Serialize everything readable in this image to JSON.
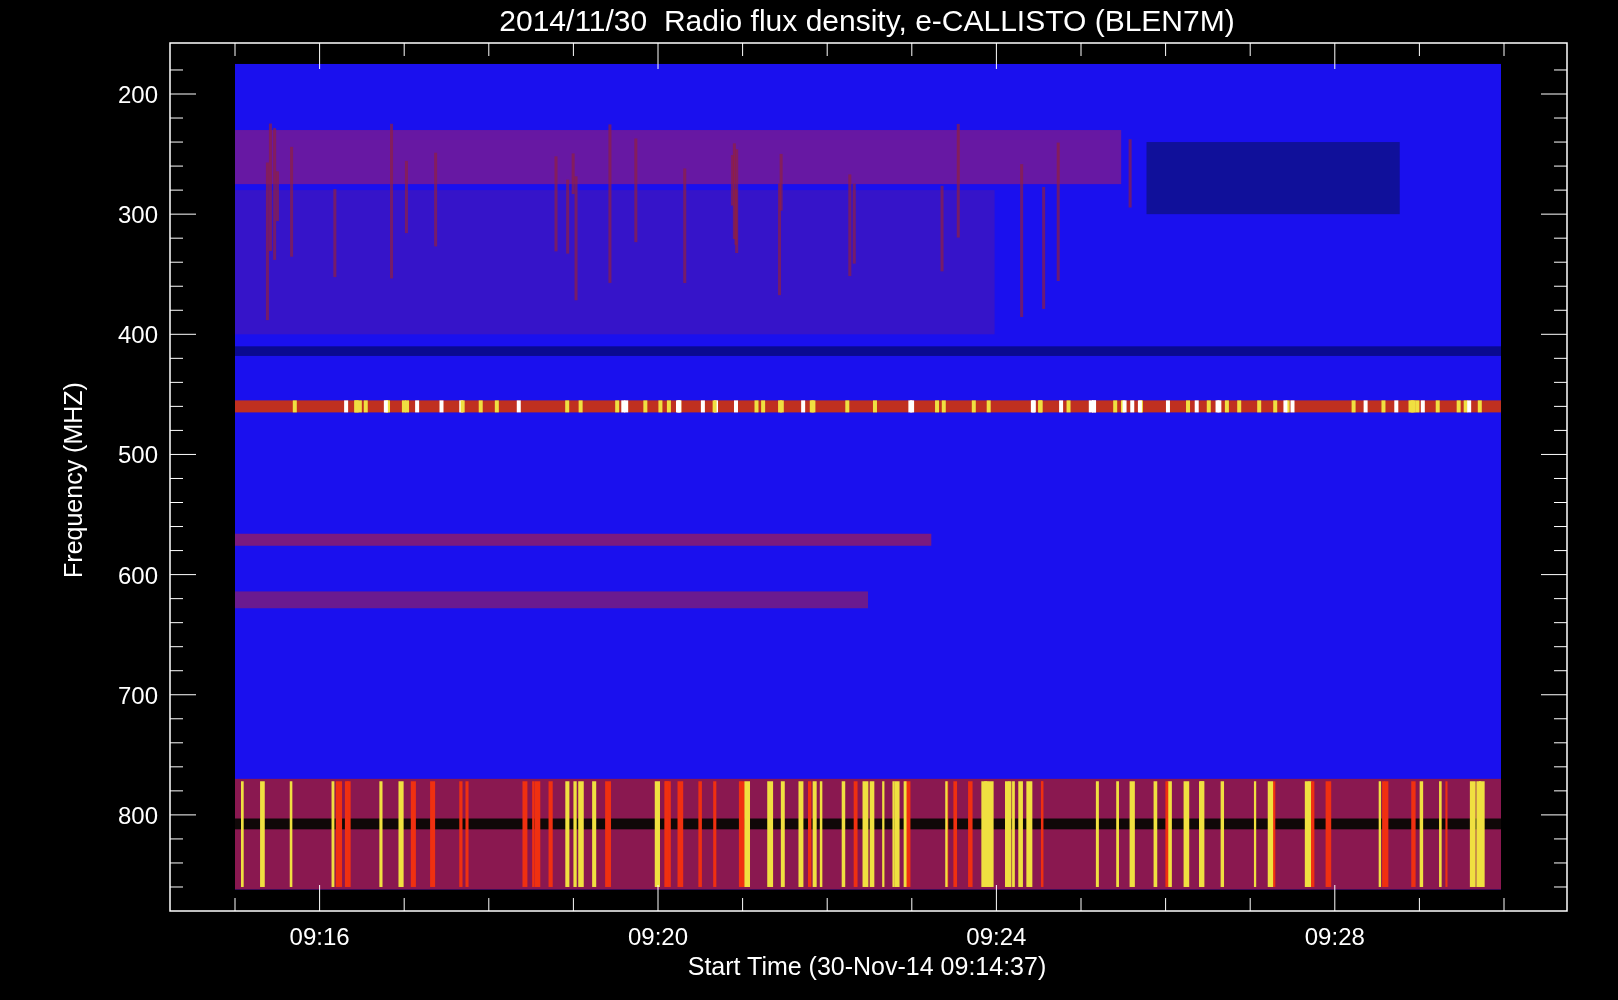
{
  "plot": {
    "title": "2014/11/30  Radio flux density, e-CALLISTO (BLEN7M)",
    "ylabel": "Frequency (MHZ)",
    "xlabel": "Start Time (30-Nov-14 09:14:37)",
    "y_tick_labels": [
      "200",
      "300",
      "400",
      "500",
      "600",
      "700",
      "800"
    ],
    "x_tick_labels": [
      "09:16",
      "09:20",
      "09:24",
      "09:28"
    ]
  }
}
